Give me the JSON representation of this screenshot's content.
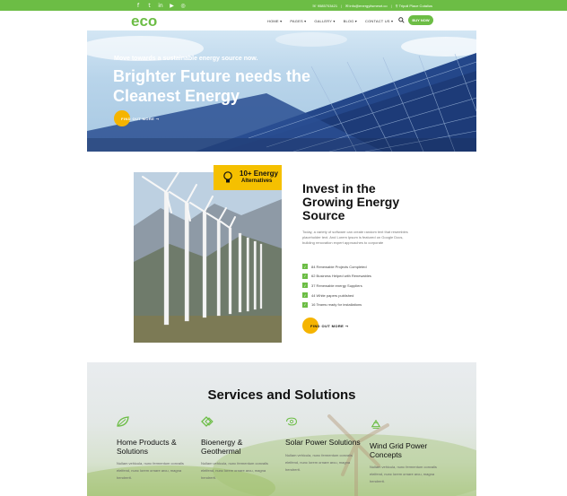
{
  "topbar": {
    "social_icons": [
      "facebook-icon",
      "twitter-icon",
      "linkedin-icon",
      "youtube-icon",
      "instagram-icon"
    ],
    "phone": "9585703421",
    "email": "info@energyitsmesrt.co",
    "address": "Tripoli Place Cutalius"
  },
  "nav": {
    "logo_text": "eco",
    "menu": [
      "HOME ▾",
      "PAGES ▾",
      "GALLERY ▾",
      "BLOG ▾",
      "CONTACT US ▾"
    ],
    "buy_label": "BUY NOW"
  },
  "hero": {
    "kicker": "Move towards a sustainable energy source now.",
    "title": "Brighter Future needs the Cleanest Energy",
    "button_label": "FIND OUT MORE ➞"
  },
  "invest": {
    "badge_number": "10+ Energy",
    "badge_label": "Alternatives",
    "title": "Invest in the Growing Energy Source",
    "text": "Today, a variety of software can create random text that resembles placeholder text. And Lorem Ipsum is featured on Google Docs, building renovation expert approaches to corporate",
    "checklist": [
      "84 Renewable Projects Completed",
      "62 Business Helped with Renewables",
      "37 Renewable energy Suppliers",
      "44 White papers published",
      "16 Teams ready for installations"
    ],
    "button_label": "FIND OUT MORE ➞"
  },
  "services": {
    "title": "Services and Solutions",
    "items": [
      {
        "title": "Home Products & Solutions",
        "text": "Nullam vehicula, nunc fermentum convalis eleifend, nunc lorem ornare arcu, magna hendrerit.",
        "icon": "leaf-icon"
      },
      {
        "title": "Bioenergy & Geothermal",
        "text": "Nullam vehicula, nunc fermentum convalis eleifend, nunc lorem ornare arcu, magna hendrerit.",
        "icon": "bioenergy-icon"
      },
      {
        "title": "Solar Power Solutions",
        "text": "Nullam vehicula, nunc fermentum convalis eleifend, nunc lorem ornare arcu, magna hendrerit.",
        "icon": "solar-icon"
      },
      {
        "title": "Wind Grid Power Concepts",
        "text": "Nullam vehicula, nunc fermentum convalis eleifend, nunc lorem ornare arcu, magna hendrerit.",
        "icon": "recycle-icon"
      }
    ]
  },
  "colors": {
    "brand_green": "#6cbd45",
    "accent_yellow": "#f5b400"
  }
}
